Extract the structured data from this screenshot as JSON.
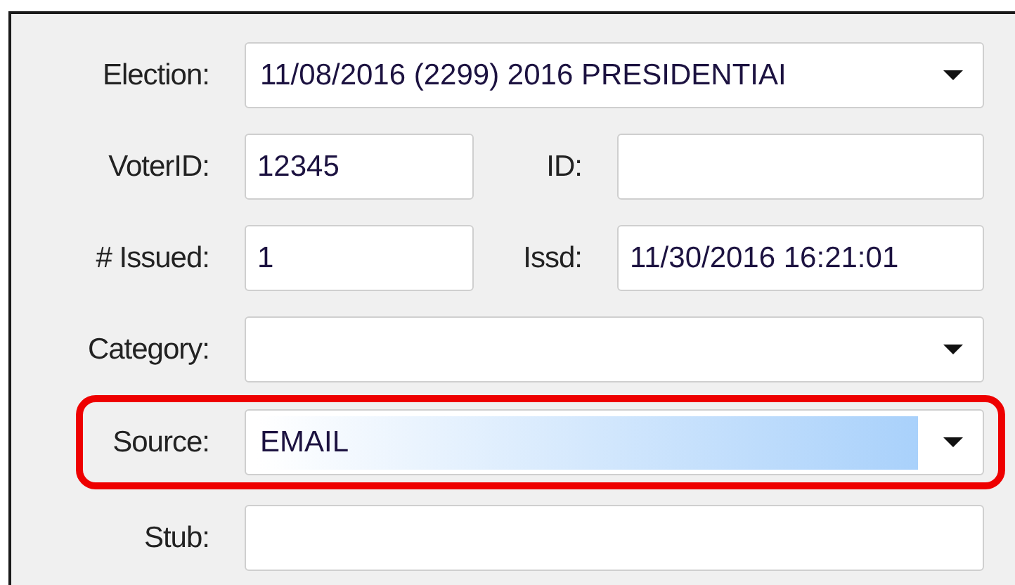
{
  "rows": [
    {
      "highlighted": false,
      "cells": [
        {
          "label": "Election:",
          "kind": "dropdown",
          "value": "11/08/2016 (2299) 2016 PRESIDENTIAI",
          "value_selected": false
        }
      ]
    },
    {
      "highlighted": false,
      "cells": [
        {
          "label": "VoterID:",
          "kind": "text",
          "value": "12345"
        },
        {
          "label": "ID:",
          "kind": "text"
        }
      ]
    },
    {
      "highlighted": false,
      "cells": [
        {
          "label": "# Issued:",
          "kind": "text",
          "value": "1"
        },
        {
          "label": "Issd:",
          "kind": "text",
          "value": "11/30/2016 16:21:01"
        }
      ]
    },
    {
      "highlighted": false,
      "cells": [
        {
          "label": "Category:",
          "kind": "dropdown",
          "value_selected": false
        }
      ]
    },
    {
      "highlighted": true,
      "cells": [
        {
          "label": "Source:",
          "kind": "dropdown",
          "value": "EMAIL",
          "value_selected": true
        }
      ]
    },
    {
      "highlighted": false,
      "cells": [
        {
          "label": "Stub:",
          "kind": "text"
        }
      ]
    }
  ]
}
